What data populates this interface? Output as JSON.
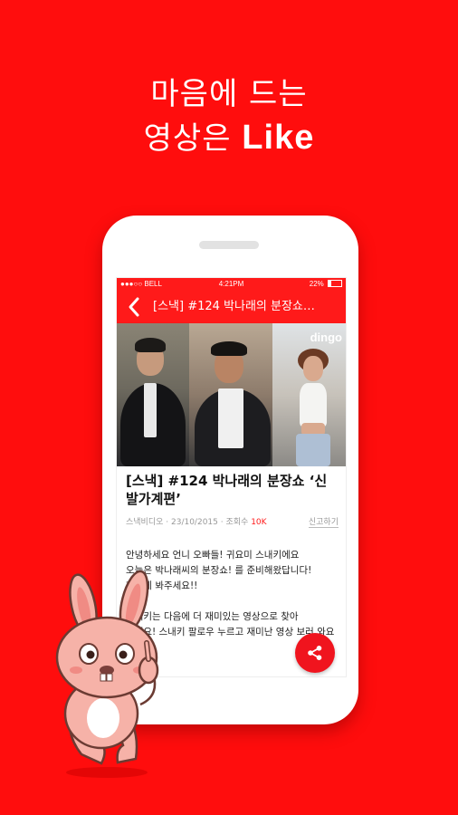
{
  "headline": {
    "line1": "마음에 드는",
    "line2_prefix": "영상은 ",
    "line2_bold": "Like"
  },
  "status_bar": {
    "carrier": "●●●○○ BELL",
    "time": "4:21PM",
    "battery": "22%",
    "battery_level": 0.22
  },
  "nav": {
    "title": "[스낵] #124 박나래의 분장쇼…",
    "back_icon": "chevron-left-icon"
  },
  "video": {
    "watermark": "dingo"
  },
  "detail": {
    "title": "[스낵] #124 박나래의 분장쇼 ‘신발가계편’",
    "channel": "스낵비디오",
    "date": "23/10/2015",
    "views_label": "조회수",
    "views": "10K",
    "report": "신고하기"
  },
  "description": [
    "안녕하세요 언니 오빠들! 귀요미 스내키에요",
    "오늘은 박나래씨의 분장쇼! 를 준비해왔답니다!",
    "재밌게 봐주세요!!",
    "",
    "스내키는 다음에 더 재미있는 영상으로 찾아",
    "올게요! 스내키 팔로우 누르고 재미난 영상 보러 와요"
  ],
  "colors": {
    "brand": "#ff0d0d",
    "accent": "#ff1a1a",
    "fab": "#f0141e"
  },
  "fab": {
    "icon": "share-icon"
  }
}
